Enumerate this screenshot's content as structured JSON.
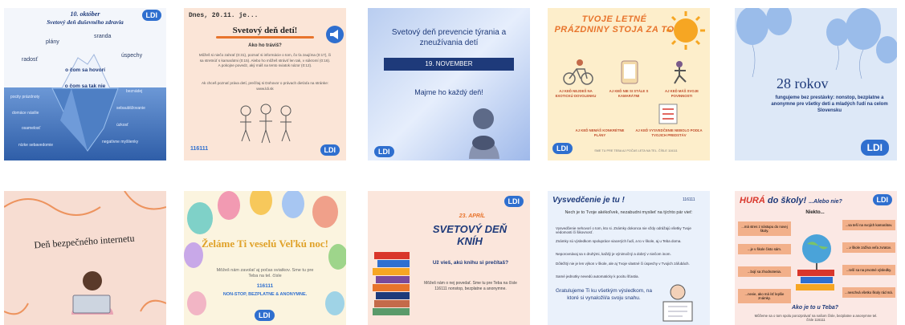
{
  "tiles": [
    {
      "date": "10. október",
      "title": "Svetový deň duševného zdravia",
      "words_top": [
        "sranda",
        "plány",
        "úspechy",
        "radosť"
      ],
      "tip_line1": "o čom sa hovorí",
      "tip_line2": "o čom sa tak nie",
      "words_bottom": [
        "pocity prázdnoty",
        "beznádej",
        "domáce násilie",
        "sebaubližovanie",
        "osamelosť",
        "úzkosť",
        "nízke sebavedomie",
        "negatívne myšlienky"
      ]
    },
    {
      "header": "Dnes, 20.11. je...",
      "title": "Svetový deň detí!",
      "subtitle": "Ako ho tráviš?",
      "body1": "Môžeš si niečo zahrať (0:31), poznať si informácie o tom, čo ťa zaujíma (0:17), či sa stretnúť s kamarátmi (0:15). Alebo ho môžeš stráviť len tak, v súkromí (0:16). A pokojne povedz, aký máš na tento sviatok názor (0:12).",
      "body2": "Ak chceš poznať práva detí, prečítaj si Dohovor o právach dieťaťa na stránke: www.ldi.sk",
      "phone": "116111"
    },
    {
      "title": "Svetový deň prevencie týrania a zneužívania detí",
      "date_badge": "19. NOVEMBER",
      "tagline": "Majme ho každý deň!"
    },
    {
      "title": "TVOJE LETNÉ PRÁZDNINY STOJA ZA TO",
      "items": [
        "AJ KEĎ NEJDEŠ NA EXOTICKÚ DOVOLENKU",
        "AJ KEĎ NIE SI STÁLE S KAMARÁTMI",
        "AJ KEĎ MÁŠ SVOJE POVINNOSTI",
        "AJ KEĎ NEMÁŠ KONKRÉTNE PLÁNY",
        "AJ KEĎ VYSVEDČENIE NEBOLO PODĽA TVOJICH PREDSTÁV"
      ],
      "footer": "SME TU PRE TEBA AJ POČAS LETA NA TEL. ČÍSLE 116111"
    },
    {
      "title": "28 rokov",
      "body": "fungujeme bez prestávky: nonstop, bezplatne a anonymne pre všetky deti a mladých ľudí na celom Slovensku"
    },
    {
      "title": "Deň bezpečného internetu"
    },
    {
      "title": "Želáme Ti veselú Veľkú noc!",
      "body": "Môžeš nám zavolať aj počas sviatkov. Sme tu pre Teba na tel. čísle",
      "phone": "116111",
      "footer": "NON-STOP, BEZPLATNE & ANONYMNE."
    },
    {
      "date": "23. APRÍL",
      "title": "SVETOVÝ DEŇ KNÍH",
      "question": "Už vieš, akú knihu si prečítaš?",
      "body": "Môžeš nám o nej povedať. Sme tu pre Teba na čísle 116111 nonstop, bezplatne a anonymne."
    },
    {
      "title": "Vysvedčenie je tu !",
      "phone": "116111",
      "intro": "Nech je to Tvoje akékoľvek, nezabudni myslieť na týchto pár vieť:",
      "bullets": [
        "Vysvedčenie nehovorí o tom, kto si. Známky dokonca nie vždy odrážajú všetky Tvoje vedomosti či šikovnosť.",
        "Známky sú výsledkom spolupráce viacerých ľudí, a to v škole, aj u Teba doma.",
        "Neporovnávaj sa s druhými, každý je výnimočný a dobrý v niečom inom.",
        "Dôležitý nie je len výkon v škole, ale aj Tvoje vlastné či úspechy v Tvojich záľubách.",
        "Samé jednotky nevedú automaticky k pocitu šťastia."
      ],
      "outro": "Gratulujeme Ti ku všetkým výsledkom, na ktoré si vynaložil/a svoju snahu."
    },
    {
      "title_prefix": "HURÁ",
      "title_rest": "do školy!",
      "title_suffix": "...Alebo nie?",
      "niekto": "Niekto...",
      "arrows_left": [
        "...má stres z nástupu do novej školy.",
        "...je v škole čisto sám.",
        "...bojí sa zhodnotenia.",
        "...nevie, ako má ísť lepšie známky."
      ],
      "arrows_right": [
        "...sa teší na svojich kamarátov.",
        "...v škole zažíva veľa zvratov.",
        "...teší sa na prvotné výsledky.",
        "...neschvá všetko školy rád má."
      ],
      "question": "Ako je to u Teba?",
      "footer": "Môžeme sa o tom spolu porozprávať na našom čísle, bezplatne a anonymne tel. čísle 116111"
    }
  ],
  "logo_text": "LDI",
  "colors": {
    "navy": "#1e3a7a",
    "blue": "#2f6fcf",
    "orange": "#e8742c",
    "red": "#d9362b"
  }
}
